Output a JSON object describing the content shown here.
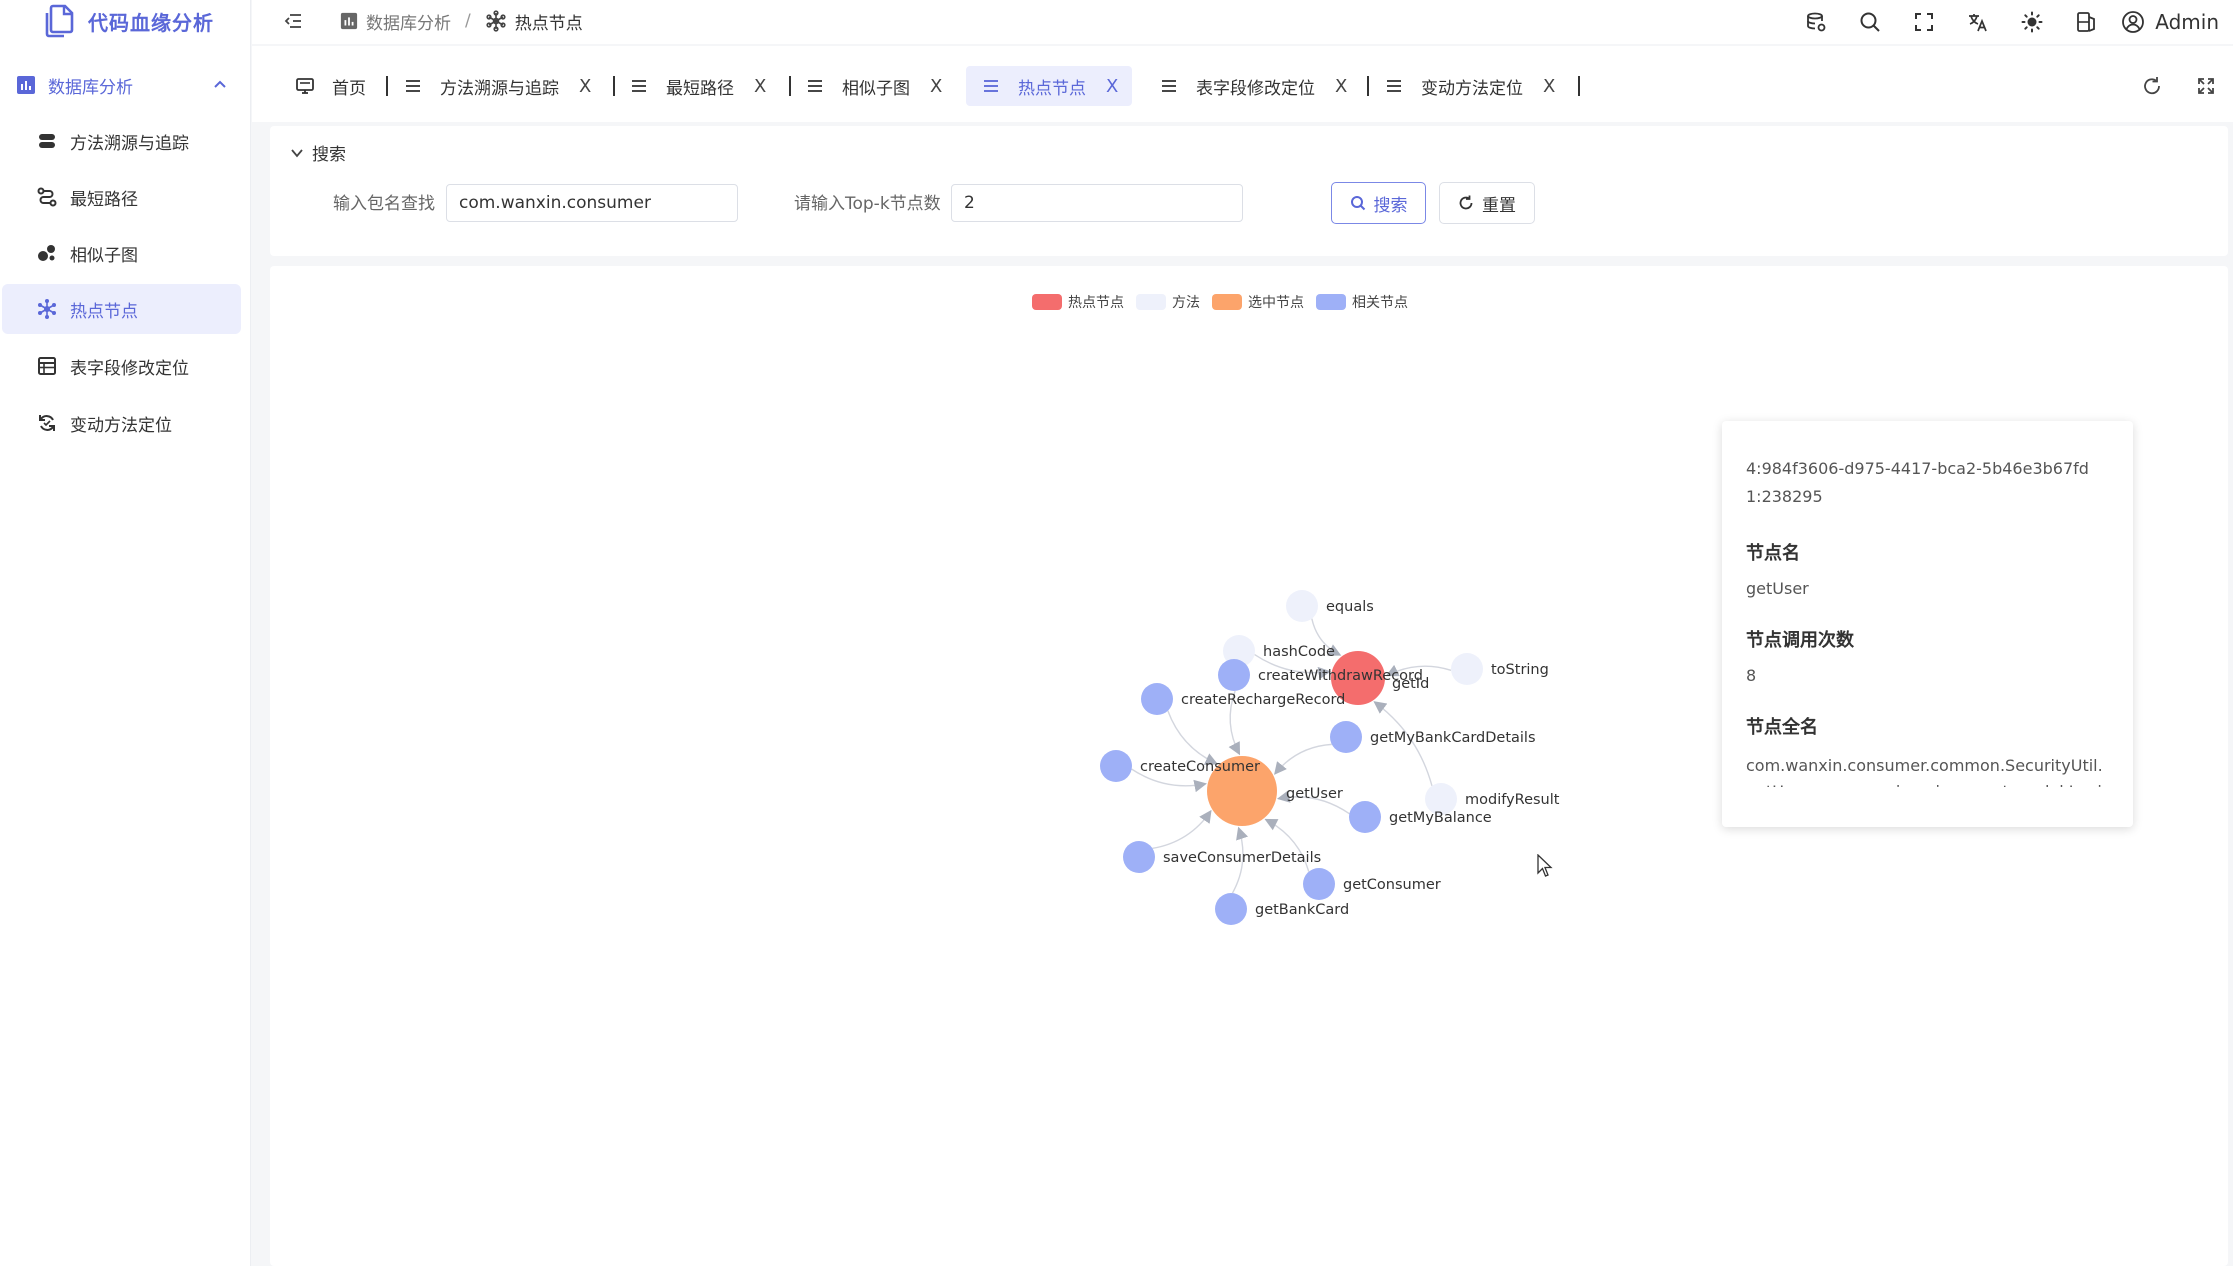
{
  "app": {
    "title": "代码血缘分析",
    "brand_color": "#5a67d8"
  },
  "sidebar": {
    "group_label": "数据库分析",
    "items": [
      {
        "label": "方法溯源与追踪",
        "icon": "database-stack-icon"
      },
      {
        "label": "最短路径",
        "icon": "route-icon"
      },
      {
        "label": "相似子图",
        "icon": "bubbles-icon"
      },
      {
        "label": "热点节点",
        "icon": "network-hub-icon",
        "active": true
      },
      {
        "label": "表字段修改定位",
        "icon": "table-list-icon"
      },
      {
        "label": "变动方法定位",
        "icon": "refresh-cycle-icon"
      }
    ]
  },
  "header": {
    "breadcrumb": [
      "数据库分析",
      "热点节点"
    ],
    "separator": "/",
    "user": "Admin"
  },
  "tabs": [
    {
      "label": "首页",
      "closable": false,
      "icon": "monitor-icon"
    },
    {
      "label": "方法溯源与追踪",
      "closable": true,
      "icon": "menu-lines-icon"
    },
    {
      "label": "最短路径",
      "closable": true,
      "icon": "menu-lines-icon"
    },
    {
      "label": "相似子图",
      "closable": true,
      "icon": "menu-lines-icon"
    },
    {
      "label": "热点节点",
      "closable": true,
      "icon": "menu-lines-icon",
      "active": true
    },
    {
      "label": "表字段修改定位",
      "closable": true,
      "icon": "menu-lines-icon"
    },
    {
      "label": "变动方法定位",
      "closable": true,
      "icon": "menu-lines-icon"
    }
  ],
  "tab_close": "X",
  "search": {
    "title": "搜索",
    "package_label": "输入包名查找",
    "package_value": "com.wanxin.consumer",
    "topk_label": "请输入Top-k节点数",
    "topk_value": "2",
    "search_button": "搜索",
    "reset_button": "重置"
  },
  "legend": [
    {
      "label": "热点节点",
      "color": "#f46d6d"
    },
    {
      "label": "方法",
      "color": "#eef1fb"
    },
    {
      "label": "选中节点",
      "color": "#fca46b"
    },
    {
      "label": "相关节点",
      "color": "#9eb0f7"
    }
  ],
  "graph": {
    "nodes": [
      {
        "id": "getId",
        "label": "getId",
        "type": "hot"
      },
      {
        "id": "equals",
        "label": "equals",
        "type": "method"
      },
      {
        "id": "hashCode",
        "label": "hashCode",
        "type": "method"
      },
      {
        "id": "toString",
        "label": "toString",
        "type": "method"
      },
      {
        "id": "modifyResult",
        "label": "modifyResult",
        "type": "method"
      },
      {
        "id": "getUser",
        "label": "getUser",
        "type": "selected"
      },
      {
        "id": "createWithdrawRecord",
        "label": "createWithdrawRecord",
        "type": "related"
      },
      {
        "id": "createRechargeRecord",
        "label": "createRechargeRecord",
        "type": "related"
      },
      {
        "id": "getMyBankCardDetails",
        "label": "getMyBankCardDetails",
        "type": "related"
      },
      {
        "id": "createConsumer",
        "label": "createConsumer",
        "type": "related"
      },
      {
        "id": "getMyBalance",
        "label": "getMyBalance",
        "type": "related"
      },
      {
        "id": "saveConsumerDetails",
        "label": "saveConsumerDetails",
        "type": "related"
      },
      {
        "id": "getConsumer",
        "label": "getConsumer",
        "type": "related"
      },
      {
        "id": "getBankCard",
        "label": "getBankCard",
        "type": "related"
      }
    ],
    "edges": [
      [
        "equals",
        "getId"
      ],
      [
        "hashCode",
        "getId"
      ],
      [
        "toString",
        "getId"
      ],
      [
        "modifyResult",
        "getId"
      ],
      [
        "createWithdrawRecord",
        "getUser"
      ],
      [
        "createRechargeRecord",
        "getUser"
      ],
      [
        "getMyBankCardDetails",
        "getUser"
      ],
      [
        "createConsumer",
        "getUser"
      ],
      [
        "getMyBalance",
        "getUser"
      ],
      [
        "saveConsumerDetails",
        "getUser"
      ],
      [
        "getConsumer",
        "getUser"
      ],
      [
        "getBankCard",
        "getUser"
      ]
    ]
  },
  "tooltip": {
    "node_id": "4:984f3606-d975-4417-bca2-5b46e3b67fd1:238295",
    "name_label": "节点名",
    "name_value": "getUser",
    "count_label": "节点调用次数",
    "count_value": "8",
    "fullname_label": "节点全名",
    "fullname_value": "com.wanxin.consumer.common.SecurityUtil.getUser;com.wanxin.api.account.model.LoginUser"
  }
}
